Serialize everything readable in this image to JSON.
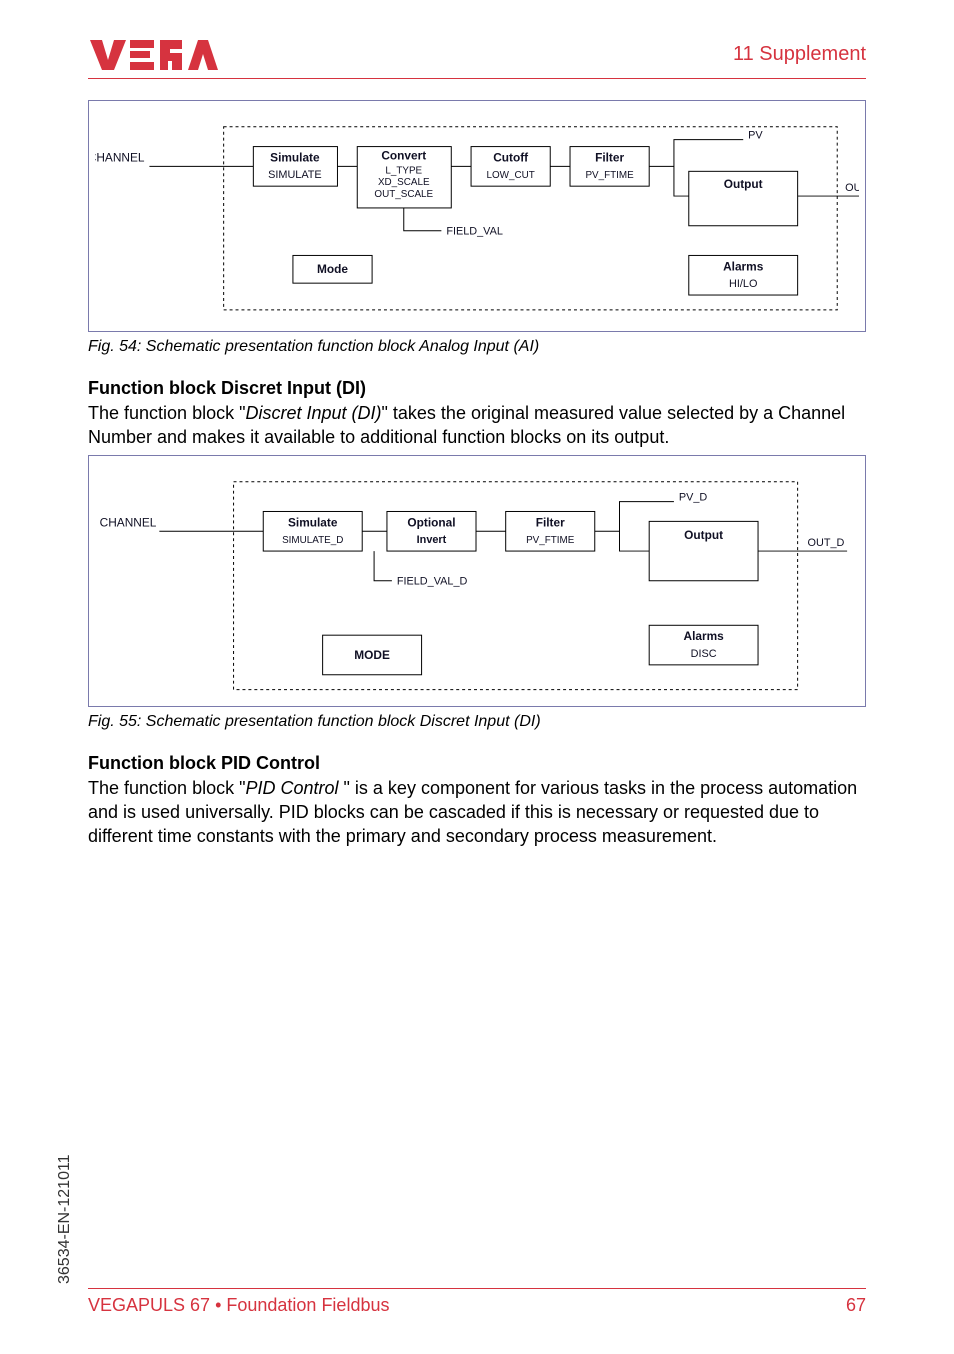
{
  "header": {
    "section": "11 Supplement"
  },
  "fig54": {
    "caption": "Fig. 54: Schematic presentation function block Analog Input (AI)",
    "lbl_channel": "CHANNEL",
    "lbl_pv": "PV",
    "lbl_out": "OUT",
    "lbl_fieldval": "FIELD_VAL",
    "sim_t": "Simulate",
    "sim_b": "SIMULATE",
    "conv_t": "Convert",
    "conv_l1": "L_TYPE",
    "conv_l2": "XD_SCALE",
    "conv_l3": "OUT_SCALE",
    "cut_t": "Cutoff",
    "cut_b": "LOW_CUT",
    "fil_t": "Filter",
    "fil_b": "PV_FTIME",
    "out_t": "Output",
    "mode_t": "Mode",
    "alm_t": "Alarms",
    "alm_b": "HI/LO"
  },
  "di": {
    "title": "Function block Discret Input (DI)",
    "text_a": "The function block \"",
    "text_em": "Discret Input (DI)",
    "text_b": "\" takes the original measured value selected by a Channel Number and makes it available to additional function blocks on its output."
  },
  "fig55": {
    "caption": "Fig. 55: Schematic presentation function block Discret Input (DI)",
    "lbl_channel": "CHANNEL",
    "lbl_pvd": "PV_D",
    "lbl_outd": "OUT_D",
    "lbl_fieldvald": "FIELD_VAL_D",
    "sim_t": "Simulate",
    "sim_b": "SIMULATE_D",
    "opt_t": "Optional",
    "opt_b": "Invert",
    "fil_t": "Filter",
    "fil_b": "PV_FTIME",
    "out_t": "Output",
    "mode_t": "MODE",
    "alm_t": "Alarms",
    "alm_b": "DISC"
  },
  "pid": {
    "title": "Function block PID Control",
    "text_a": "The function block \"",
    "text_em": "PID Control ",
    "text_b": "\" is a key component for various tasks in the process automation and is used universally. PID blocks can be cascaded if this is necessary or requested due to different time constants with the primary and secondary process measurement."
  },
  "footer": {
    "left": "VEGAPULS 67 • Foundation Fieldbus",
    "right": "67"
  },
  "docid": "36534-EN-121011"
}
